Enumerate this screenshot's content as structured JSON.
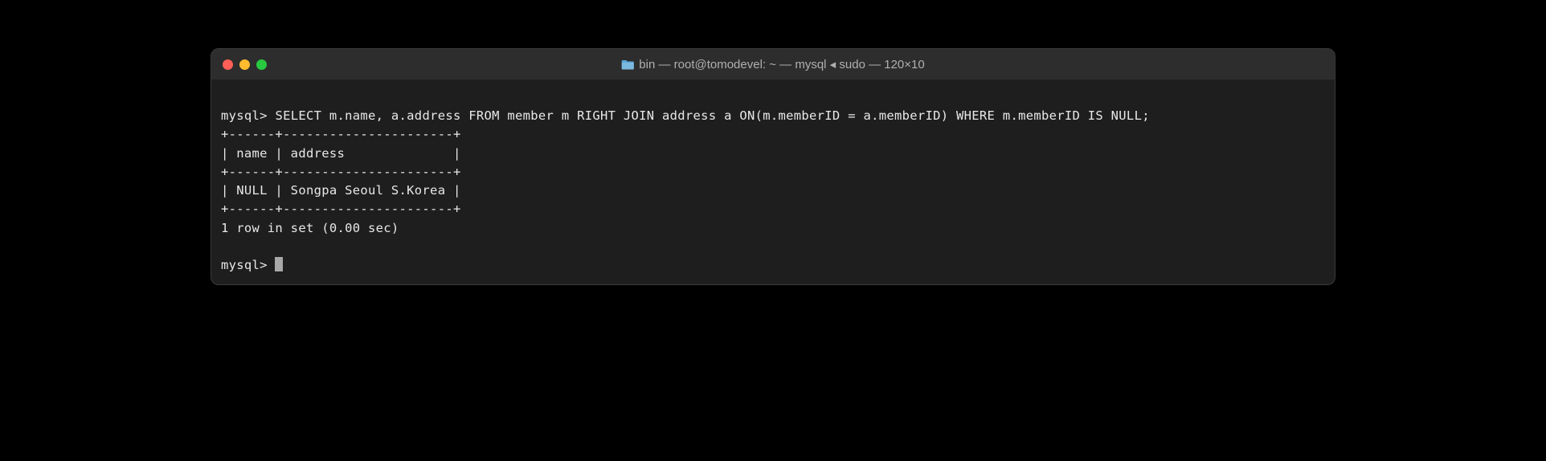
{
  "window": {
    "title": "bin — root@tomodevel: ~ — mysql ◂ sudo — 120×10"
  },
  "terminal": {
    "prompt1": "mysql> ",
    "query": "SELECT m.name, a.address FROM member m RIGHT JOIN address a ON(m.memberID = a.memberID) WHERE m.memberID IS NULL;",
    "sep_top": "+------+----------------------+",
    "header_row": "| name | address              |",
    "sep_mid": "+------+----------------------+",
    "data_row": "| NULL | Songpa Seoul S.Korea |",
    "sep_bot": "+------+----------------------+",
    "result_msg": "1 row in set (0.00 sec)",
    "prompt2": "mysql> "
  }
}
